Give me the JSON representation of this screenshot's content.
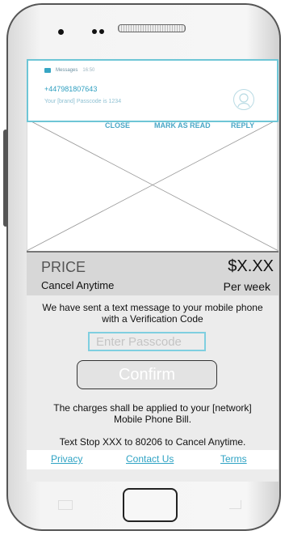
{
  "notification": {
    "app_name": "Messages",
    "time": "16:50",
    "sender": "+447981807643",
    "message": "Your [brand] Passcode is 1234",
    "actions": [
      "CLOSE",
      "MARK AS READ",
      "REPLY"
    ]
  },
  "price_box": {
    "price_label": "PRICE",
    "cancel_label": "Cancel Anytime",
    "price_value": "$X.XX",
    "period": "Per week"
  },
  "main": {
    "sent_text_line1": "We have sent a text message to your mobile phone",
    "sent_text_line2": "with a Verification Code",
    "passcode_placeholder": "Enter Passcode",
    "confirm_label": "Confirm",
    "charges_line1": "The charges shall be applied to your [network]",
    "charges_line2": "Mobile Phone Bill.",
    "stop_text": "Text Stop XXX to 80206 to Cancel Anytime."
  },
  "footer_links": {
    "privacy": "Privacy",
    "contact": "Contact Us",
    "terms": "Terms"
  },
  "colors": {
    "accent": "#2fa3c4",
    "notification_border": "#6ec6d6",
    "price_box_bg": "#d7d7d7",
    "screen_bg": "#ececec"
  }
}
